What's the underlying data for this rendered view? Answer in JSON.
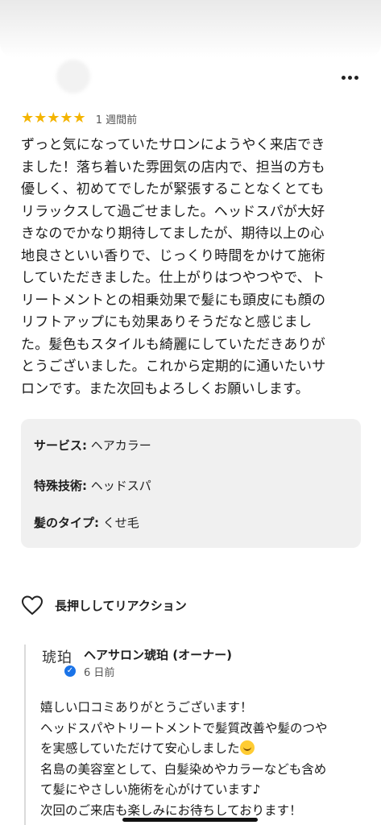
{
  "review": {
    "stars": "★★★★★",
    "rating": 5,
    "time": "1 週間前",
    "lines": [
      "ずっと気になっていたサロンにようやく来店でき",
      "ました！落ち着いた雰囲気の店内で、担当の方も",
      "優しく、初めてでしたが緊張することなくとても",
      "リラックスして過ごせました。ヘッドスパが大好",
      "きなのでかなり期待してましたが、期待以上の心",
      "地良さといい香りで、じっくり時間をかけて施術",
      "していただきました。仕上がりはつやつやで、ト",
      "リートメントとの相乗効果で髪にも頭皮にも顔の",
      "リフトアップにも効果ありそうだなと感じまし",
      "た。髪色もスタイルも綺麗にしていただきありが",
      "とうございました。これから定期的に通いたいサ",
      "ロンです。また次回もよろしくお願いします。"
    ]
  },
  "details": [
    {
      "label": "サービス:",
      "value": " ヘアカラー"
    },
    {
      "label": "特殊技術:",
      "value": " ヘッドスパ"
    },
    {
      "label": "髪のタイプ:",
      "value": " くせ毛"
    }
  ],
  "reaction": {
    "label": "長押ししてリアクション",
    "icon": "heart-outline-icon"
  },
  "owner_reply": {
    "logo_text": "琥珀",
    "name": "ヘアサロン琥珀 (オーナー)",
    "time": "6 日前",
    "lines": [
      "嬉しい口コミありがとうございます！",
      "ヘッドスパやトリートメントで髪質改善や髪のつや",
      "を実感していただけて安心しました",
      "名島の美容室として、白髪染めやカラーなども含め",
      "て髪にやさしい施術を心がけています♪",
      "次回のご来店も楽しみにお待ちしております！"
    ]
  },
  "colors": {
    "star": "#f4b400",
    "verified": "#1a73e8",
    "details_bg": "#f0f0f0"
  }
}
